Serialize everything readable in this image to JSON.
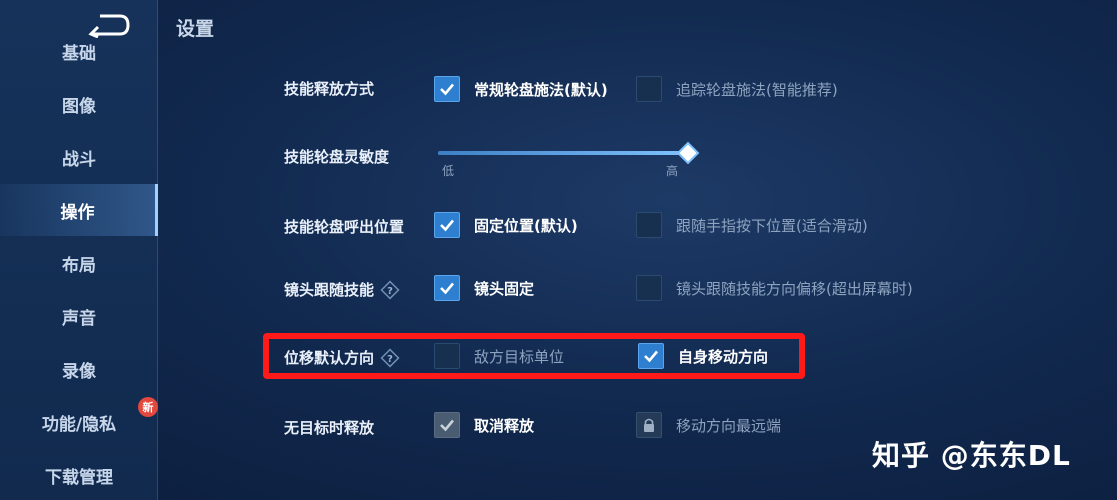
{
  "header": {
    "title": "设置"
  },
  "sidebar": {
    "items": [
      {
        "label": "基础"
      },
      {
        "label": "图像"
      },
      {
        "label": "战斗"
      },
      {
        "label": "操作"
      },
      {
        "label": "布局"
      },
      {
        "label": "声音"
      },
      {
        "label": "录像"
      },
      {
        "label": "功能/隐私"
      },
      {
        "label": "下载管理"
      }
    ],
    "active": "操作",
    "badge": "新"
  },
  "settings": {
    "skill_release": {
      "label": "技能释放方式",
      "opt1": "常规轮盘施法(默认)",
      "opt2": "追踪轮盘施法(智能推荐)"
    },
    "wheel_sensitivity": {
      "label": "技能轮盘灵敏度",
      "low": "低",
      "high": "高",
      "value": 1.0
    },
    "wheel_position": {
      "label": "技能轮盘呼出位置",
      "opt1": "固定位置(默认)",
      "opt2": "跟随手指按下位置(适合滑动)"
    },
    "camera_follow": {
      "label": "镜头跟随技能",
      "opt1": "镜头固定",
      "opt2": "镜头跟随技能方向偏移(超出屏幕时)"
    },
    "move_direction": {
      "label": "位移默认方向",
      "opt1": "敌方目标单位",
      "opt2": "自身移动方向"
    },
    "no_target": {
      "label": "无目标时释放",
      "opt1": "取消释放",
      "opt2": "移动方向最远端"
    }
  },
  "watermark": "知乎 @东东DL",
  "colors": {
    "accent": "#2e7fd0",
    "highlight": "#ff1a1a",
    "badge": "#e2483d"
  }
}
